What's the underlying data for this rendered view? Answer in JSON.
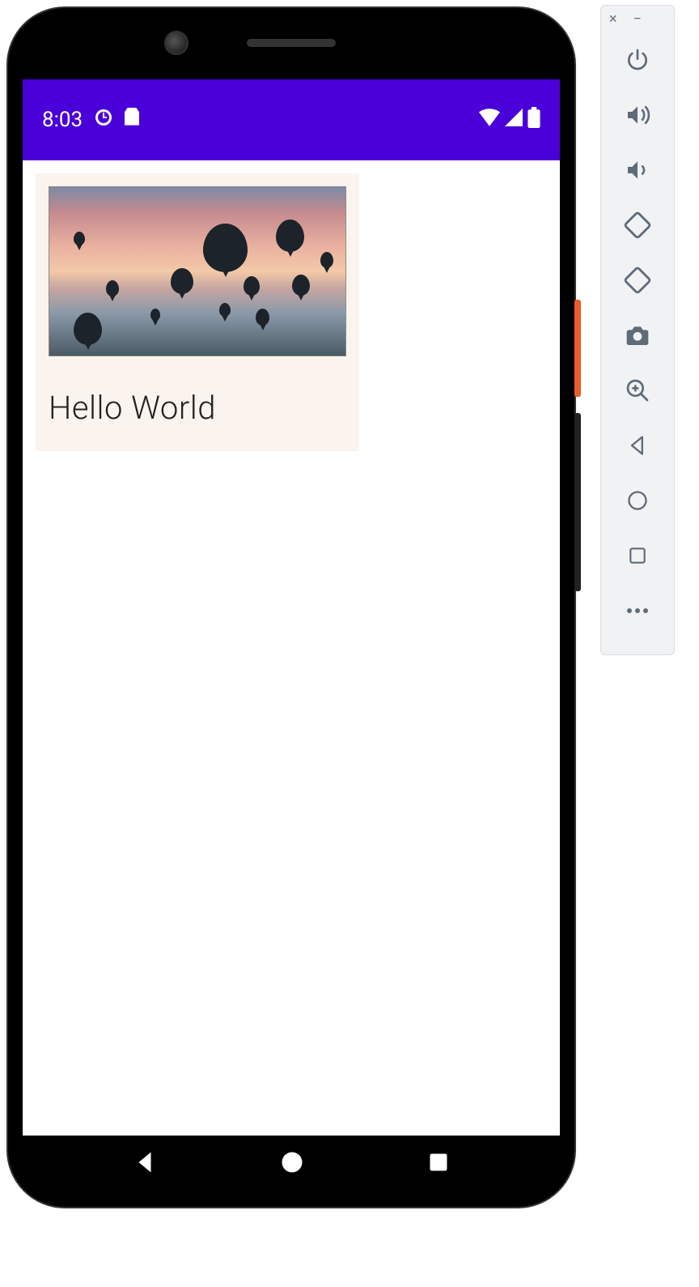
{
  "status_bar": {
    "time": "8:03",
    "icons_left": [
      "clock-icon",
      "sim-icon"
    ],
    "icons_right": [
      "wifi-icon",
      "signal-icon",
      "battery-icon"
    ]
  },
  "card": {
    "text": "Hello World",
    "image_alt": "hot-air-balloons-at-sunset"
  },
  "nav_bar": {
    "back": "back",
    "home": "home",
    "overview": "overview"
  },
  "emulator_panel": {
    "window_close": "×",
    "window_minimize": "−",
    "buttons": [
      {
        "name": "power-icon"
      },
      {
        "name": "volume-up-icon"
      },
      {
        "name": "volume-down-icon"
      },
      {
        "name": "rotate-left-icon"
      },
      {
        "name": "rotate-right-icon"
      },
      {
        "name": "camera-icon"
      },
      {
        "name": "zoom-icon"
      },
      {
        "name": "back-icon"
      },
      {
        "name": "home-icon"
      },
      {
        "name": "overview-icon"
      },
      {
        "name": "more-icon"
      }
    ]
  }
}
